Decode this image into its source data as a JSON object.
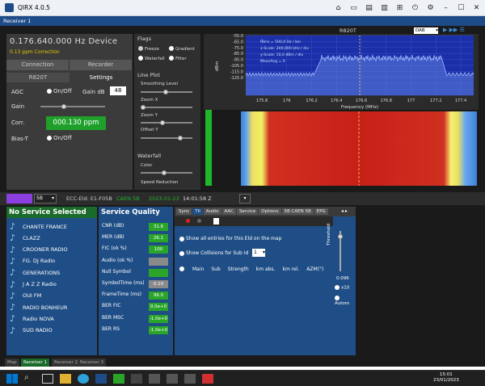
{
  "window": {
    "title": "QIRX 4.0.5"
  },
  "receiver_bar": {
    "label": "Receiver 1",
    "sub": "f"
  },
  "device": {
    "freq": "0.176.640.000 Hz Device",
    "ppm_correction": "0.13 ppm Correction"
  },
  "tabs_top": [
    "Connection",
    "Recorder"
  ],
  "tabs_sub": [
    "R820T",
    "Settings"
  ],
  "settings": {
    "agc_label": "AGC",
    "agc_value": "On/Off",
    "gain_db_label": "Gain dB",
    "gain_db_value": "48",
    "gain_label": "Gain",
    "corr_label": "Corr.",
    "corr_value": "000.130 ppm",
    "biast_label": "Bias-T",
    "biast_value": "On/Off"
  },
  "flags": {
    "title": "Flags",
    "freeze": "Freeze",
    "gradient": "Gradient",
    "waterfall": "Waterfall",
    "filter": "Filter"
  },
  "lineplot": {
    "title": "Line Plot",
    "smoothing": "Smoothing Level",
    "zoomx": "Zoom X",
    "zoomy": "Zoom Y",
    "offsety": "Offset Y"
  },
  "waterfall_sec": {
    "title": "Waterfall",
    "color": "Color",
    "speed": "Speed Reduction"
  },
  "spectrum": {
    "title": "R820T",
    "mode_select": "DAB",
    "ylabel": "dBm",
    "xlabel": "Frequency (MHz)",
    "y_ticks": [
      "-55.0",
      "-65.0",
      "-75.0",
      "-85.0",
      "-95.0",
      "-105.0",
      "-115.0",
      "-125.0",
      "-135.0",
      "-145.0",
      "-155.0"
    ],
    "x_ticks": [
      "175.8",
      "176",
      "176.2",
      "176.4",
      "176.6",
      "176.8",
      "177",
      "177.2",
      "177.4"
    ],
    "info_lines": [
      "fBins = 500,0 Hz / bin",
      "x-Scale: 200,000 kHz / div",
      "y-Scale: 10,0 dBm / div",
      "MeanAvg = 0"
    ]
  },
  "status_strip": {
    "ch_select": "5B",
    "ecc": "ECC-Eld: E1-F05B",
    "caen": "CAEN 5B",
    "date": "2023-01-23",
    "time": "14:01:58 Z"
  },
  "services": {
    "title": "No Service Selected",
    "items": [
      "CHANTE FRANCE",
      "CLAZZ",
      "CROONER RADIO",
      "FG. DJ Radio",
      "GENERATIONS",
      "J A Z Z Radio",
      "OUI FM",
      "RADIO BONHEUR",
      "Radio NOVA",
      "SUD RADIO"
    ]
  },
  "quality": {
    "title": "Service Quality",
    "rows": [
      {
        "label": "CNR (dB)",
        "value": "31.6",
        "color": "#2aa52a"
      },
      {
        "label": "MER (dB)",
        "value": "26.1",
        "color": "#2aa52a"
      },
      {
        "label": "FIC (ok %)",
        "value": "100",
        "color": "#2aa52a"
      },
      {
        "label": "Audio (ok %)",
        "value": "",
        "color": "#8a8a8a"
      },
      {
        "label": "Null Symbol",
        "value": "",
        "color": "#2aa52a"
      },
      {
        "label": "SymbolTime (ms)",
        "value": "0.10",
        "color": "#8a8a8a"
      },
      {
        "label": "FrameTime (ms)",
        "value": "96.0",
        "color": "#2aa52a"
      },
      {
        "label": "BER FIC",
        "value": "0.0e+0",
        "color": "#2aa52a"
      },
      {
        "label": "BER MSC",
        "value": "-1.0e+0",
        "color": "#2aa52a"
      },
      {
        "label": "BER RS",
        "value": "-1.0e+0",
        "color": "#2aa52a"
      }
    ]
  },
  "tii": {
    "tabs": [
      "Sync",
      "TII",
      "Audio",
      "AAC",
      "Service",
      "Options",
      "5B CAEN 5B",
      "EPG"
    ],
    "show_all": "Show all entries for this Eld on the map",
    "show_collisions": "Show Collisions for Sub Id",
    "sub_id": "1",
    "columns": [
      "Main",
      "Sub",
      "Strength",
      "km abs.",
      "km rel.",
      "AZM(°)"
    ],
    "threshold_label": "Threshold",
    "threshold_value": "0.096",
    "x10": "x10",
    "auto": "Autom"
  },
  "bottom_tabs": [
    "Map",
    "Receiver 1",
    "Receiver 2",
    "Receiver 3"
  ],
  "clock": {
    "time": "15:01",
    "date": "23/01/2023"
  }
}
